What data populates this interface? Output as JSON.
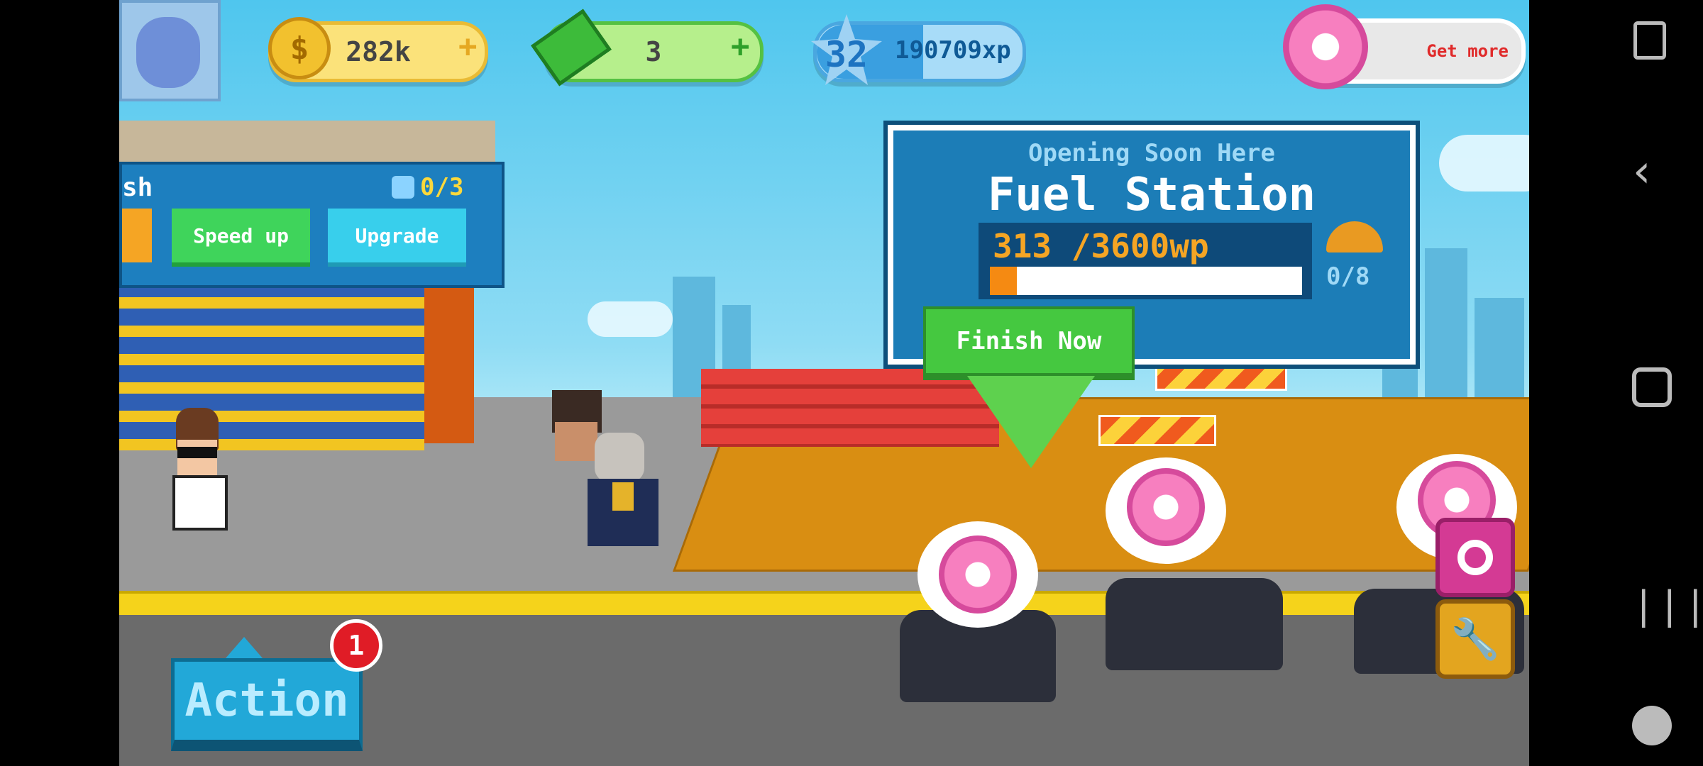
{
  "hud": {
    "coins": "282k",
    "cash": "3",
    "level": "32",
    "xp": "190709xp",
    "donut_offer": "Get more",
    "plus_symbol": "+"
  },
  "car_wash_panel": {
    "title_partial": "sh",
    "workers": "0/3",
    "speed_up_label": "Speed up",
    "upgrade_label": "Upgrade"
  },
  "construction": {
    "subtitle": "Opening Soon Here",
    "title": "Fuel Station",
    "progress_text": "313  /3600wp",
    "progress_current": 313,
    "progress_total": 3600,
    "helmets": "0/8",
    "finish_label": "Finish Now"
  },
  "action": {
    "label": "Action",
    "badge_count": "1"
  },
  "colors": {
    "coin_pill": "#fbe27a",
    "cash_pill": "#b6ef8c",
    "xp_pill": "#a8dcf8",
    "board_blue": "#1c7db7",
    "finish_green": "#45c840",
    "action_blue": "#22a8d8",
    "badge_red": "#e01c26"
  },
  "icons": [
    "coin-icon",
    "cash-icon",
    "level-star-icon",
    "donut-icon",
    "worker-icon",
    "helmet-icon",
    "arrow-down-icon",
    "wrench-icon",
    "donut-camera-icon",
    "screenshot-icon",
    "back-icon",
    "home-icon",
    "recents-icon",
    "game-tools-icon"
  ]
}
